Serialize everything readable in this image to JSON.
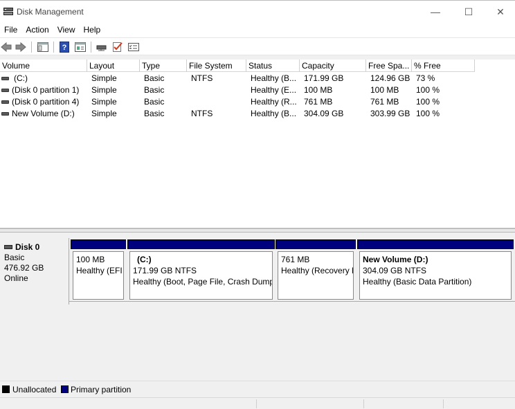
{
  "window": {
    "title": "Disk Management",
    "min_glyph": "—",
    "max_glyph": "☐",
    "close_glyph": "✕"
  },
  "menu": [
    "File",
    "Action",
    "View",
    "Help"
  ],
  "toolbar_icons": [
    "back-arrow-icon",
    "forward-arrow-icon",
    "console-tree-icon",
    "help-icon",
    "properties-icon",
    "connect-drive-icon",
    "check-icon",
    "list-view-icon"
  ],
  "columns": [
    "Volume",
    "Layout",
    "Type",
    "File System",
    "Status",
    "Capacity",
    "Free Spa...",
    "% Free"
  ],
  "volumes": [
    {
      "volume": "(C:)",
      "layout": "Simple",
      "type": "Basic",
      "fs": "NTFS",
      "status": "Healthy (B...",
      "capacity": "171.99 GB",
      "free": "124.96 GB",
      "pct": "73 %"
    },
    {
      "volume": "(Disk 0 partition 1)",
      "layout": "Simple",
      "type": "Basic",
      "fs": "",
      "status": "Healthy (E...",
      "capacity": "100 MB",
      "free": "100 MB",
      "pct": "100 %"
    },
    {
      "volume": "(Disk 0 partition 4)",
      "layout": "Simple",
      "type": "Basic",
      "fs": "",
      "status": "Healthy (R...",
      "capacity": "761 MB",
      "free": "761 MB",
      "pct": "100 %"
    },
    {
      "volume": "New Volume (D:)",
      "layout": "Simple",
      "type": "Basic",
      "fs": "NTFS",
      "status": "Healthy (B...",
      "capacity": "304.09 GB",
      "free": "303.99 GB",
      "pct": "100 %"
    }
  ],
  "disk": {
    "name": "Disk 0",
    "type": "Basic",
    "size": "476.92 GB",
    "state": "Online"
  },
  "partitions": [
    {
      "title": "",
      "line1": "100 MB",
      "line2": "Healthy (EFI"
    },
    {
      "title": "(C:)",
      "line1": "171.99 GB NTFS",
      "line2": "Healthy (Boot, Page File, Crash Dump,"
    },
    {
      "title": "",
      "line1": "761 MB",
      "line2": "Healthy (Recovery P"
    },
    {
      "title": "New Volume  (D:)",
      "line1": "304.09 GB NTFS",
      "line2": "Healthy (Basic Data Partition)"
    }
  ],
  "legend": [
    {
      "label": "Unallocated",
      "color": "#000000"
    },
    {
      "label": "Primary partition",
      "color": "#00007f"
    }
  ],
  "colors": {
    "primary_partition": "#00007f",
    "unallocated": "#000000"
  }
}
